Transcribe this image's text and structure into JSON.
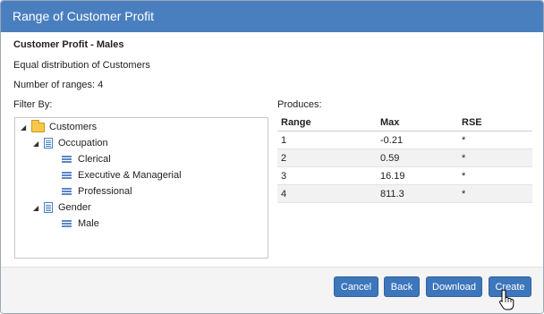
{
  "dialog": {
    "title": "Range of Customer Profit",
    "subtitle": "Customer Profit - Males",
    "description": "Equal distribution of Customers",
    "ranges_text": "Number of ranges: 4",
    "filter_label": "Filter By:",
    "produces_label": "Produces:"
  },
  "tree": {
    "root": "Customers",
    "occupation": "Occupation",
    "occupation_items": [
      "Clerical",
      "Executive & Managerial",
      "Professional"
    ],
    "gender": "Gender",
    "gender_items": [
      "Male"
    ]
  },
  "results": {
    "headers": [
      "Range",
      "Max",
      "RSE"
    ],
    "rows": [
      [
        "1",
        "-0.21",
        "*"
      ],
      [
        "2",
        "0.59",
        "*"
      ],
      [
        "3",
        "16.19",
        "*"
      ],
      [
        "4",
        "811.3",
        "*"
      ]
    ]
  },
  "buttons": {
    "cancel": "Cancel",
    "back": "Back",
    "download": "Download",
    "create": "Create"
  },
  "colors": {
    "titlebar": "#4a7fbf",
    "button": "#3d76bb",
    "folder": "#f5c84c"
  },
  "icons": [
    "folder-icon",
    "document-icon",
    "list-lines-icon",
    "expand-triangle-icon",
    "hand-cursor-icon"
  ]
}
